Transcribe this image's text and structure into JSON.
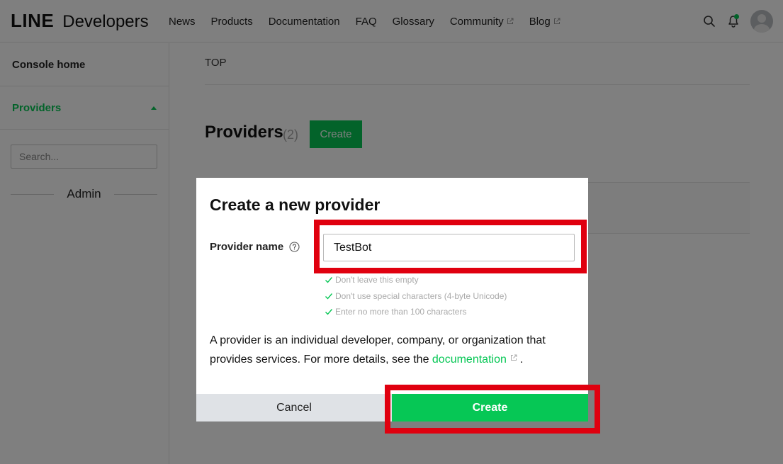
{
  "header": {
    "logo_bold": "LINE",
    "logo_rest": "Developers",
    "nav": [
      {
        "label": "News",
        "external": false
      },
      {
        "label": "Products",
        "external": false
      },
      {
        "label": "Documentation",
        "external": false
      },
      {
        "label": "FAQ",
        "external": false
      },
      {
        "label": "Glossary",
        "external": false
      },
      {
        "label": "Community",
        "external": true
      },
      {
        "label": "Blog",
        "external": true
      }
    ]
  },
  "sidebar": {
    "home_label": "Console home",
    "providers_label": "Providers",
    "search_placeholder": "Search...",
    "section_label": "Admin"
  },
  "main": {
    "breadcrumb": "TOP",
    "title": "Providers",
    "count": "(2)",
    "create_label": "Create"
  },
  "dialog": {
    "title": "Create a new provider",
    "field_label": "Provider name",
    "field_value": "TestBot",
    "rules": [
      "Don't leave this empty",
      "Don't use special characters (4-byte Unicode)",
      "Enter no more than 100 characters"
    ],
    "description_before": "A provider is an individual developer, company, or organization that provides services. For more details, see the ",
    "link_text": "documentation",
    "description_after": ".",
    "cancel_label": "Cancel",
    "create_label": "Create"
  },
  "colors": {
    "brand_green": "#06c755",
    "highlight_red": "#e0000f",
    "overlay": "rgba(0,0,0,0.5)"
  }
}
